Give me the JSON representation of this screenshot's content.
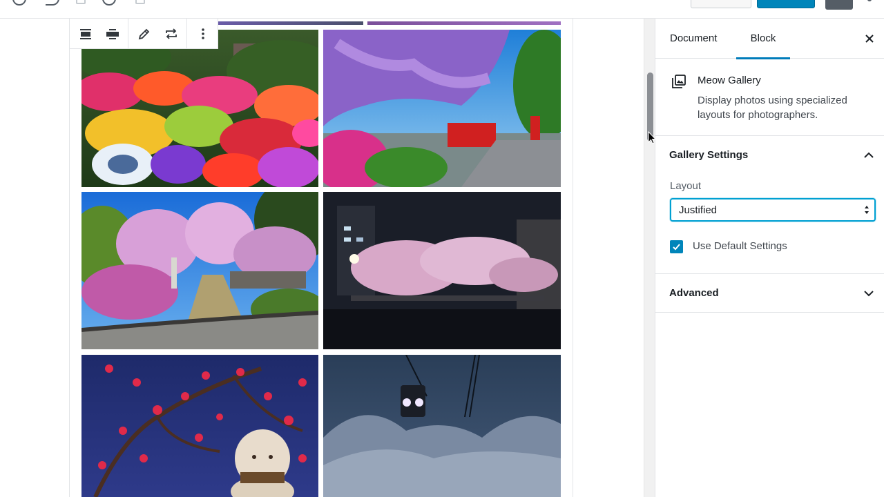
{
  "sidebar": {
    "tabs": {
      "document": "Document",
      "block": "Block"
    },
    "block_card": {
      "name": "Meow Gallery",
      "description": "Display photos using specialized layouts for photographers."
    },
    "gallery_settings": {
      "title": "Gallery Settings",
      "layout_label": "Layout",
      "layout_value": "Justified",
      "use_default_label": "Use Default Settings",
      "use_default_checked": true
    },
    "advanced": {
      "title": "Advanced"
    }
  },
  "block_toolbar": {
    "icons": [
      "wide-width-icon",
      "full-width-icon",
      "edit-icon",
      "replace-icon",
      "more-options-icon"
    ]
  },
  "gallery": {
    "photos": [
      "azalea-garden",
      "wisteria-red-bridge",
      "cherry-blossom-path",
      "night-cherry-blossoms",
      "plum-blossoms-lucky-cat",
      "ropeway-snowy-forest"
    ]
  },
  "colors": {
    "accent": "#007cba",
    "focus": "#00a0d2",
    "checkbox": "#0085ba"
  }
}
